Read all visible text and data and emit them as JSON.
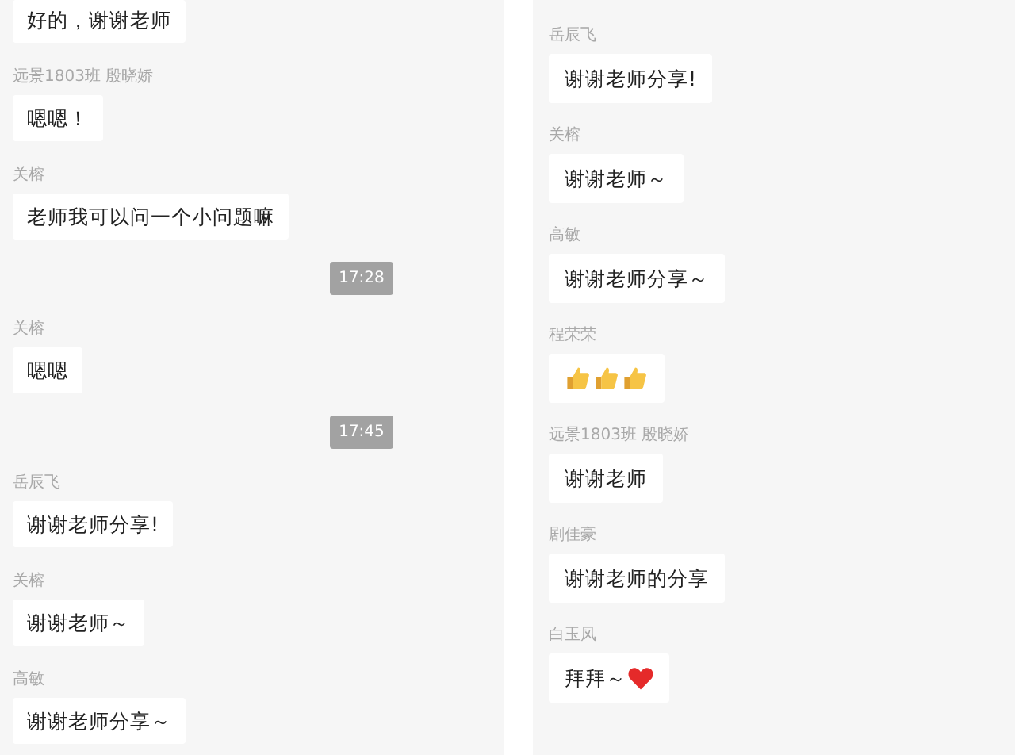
{
  "panels": [
    {
      "items": [
        {
          "kind": "text",
          "text": "好的，谢谢老师"
        },
        {
          "kind": "sender",
          "text": "远景1803班 殷晓娇"
        },
        {
          "kind": "text",
          "text": "嗯嗯！"
        },
        {
          "kind": "sender",
          "text": "关榕"
        },
        {
          "kind": "text",
          "text": "老师我可以问一个小问题嘛"
        },
        {
          "kind": "time",
          "text": "17:28"
        },
        {
          "kind": "sender",
          "text": "关榕"
        },
        {
          "kind": "text",
          "text": "嗯嗯"
        },
        {
          "kind": "time",
          "text": "17:45"
        },
        {
          "kind": "sender",
          "text": "岳辰飞"
        },
        {
          "kind": "text",
          "text": "谢谢老师分享!"
        },
        {
          "kind": "sender",
          "text": "关榕"
        },
        {
          "kind": "text",
          "text": "谢谢老师～"
        },
        {
          "kind": "sender",
          "text": "高敏"
        },
        {
          "kind": "text",
          "text": "谢谢老师分享～"
        }
      ]
    },
    {
      "items": [
        {
          "kind": "sender",
          "text": "岳辰飞"
        },
        {
          "kind": "text",
          "text": "谢谢老师分享!"
        },
        {
          "kind": "sender",
          "text": "关榕"
        },
        {
          "kind": "text",
          "text": "谢谢老师～"
        },
        {
          "kind": "sender",
          "text": "高敏"
        },
        {
          "kind": "text",
          "text": "谢谢老师分享～"
        },
        {
          "kind": "sender",
          "text": "程荣荣"
        },
        {
          "kind": "thumbs"
        },
        {
          "kind": "sender",
          "text": "远景1803班 殷晓娇"
        },
        {
          "kind": "text",
          "text": "谢谢老师"
        },
        {
          "kind": "sender",
          "text": "剧佳豪"
        },
        {
          "kind": "text",
          "text": "谢谢老师的分享"
        },
        {
          "kind": "sender",
          "text": "白玉凤"
        },
        {
          "kind": "text-heart",
          "text": "拜拜～"
        }
      ]
    }
  ]
}
